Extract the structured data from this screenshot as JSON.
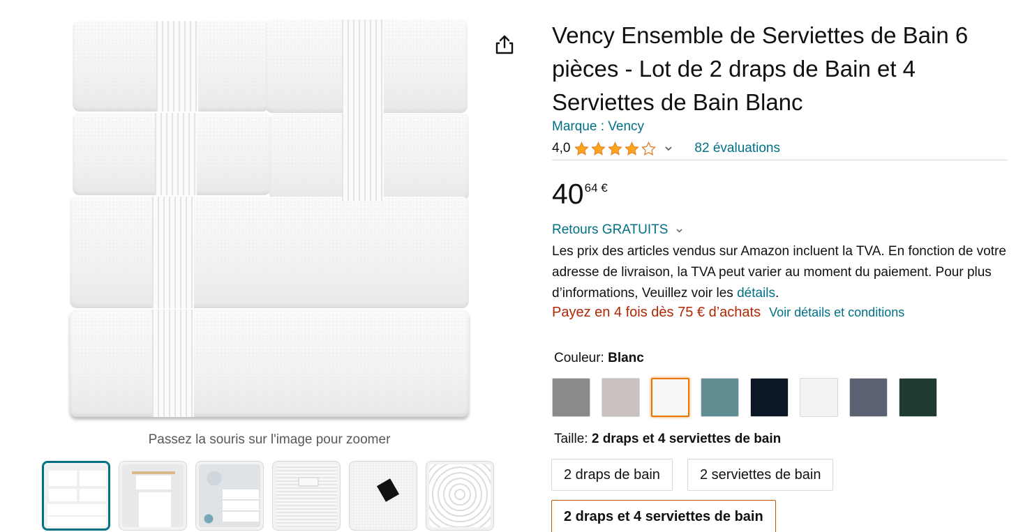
{
  "product": {
    "title": "Vency Ensemble de Serviettes de Bain 6 pièces - Lot de 2 draps de Bain et 4 Serviettes de Bain Blanc",
    "brand_link": "Marque : Vency",
    "rating_value": "4,0",
    "rating_stars": 4,
    "rating_max": 5,
    "reviews_link": "82 évaluations",
    "price_whole": "40",
    "price_fraction": "64 €",
    "returns_label": "Retours GRATUITS",
    "tva_text": "Les prix des articles vendus sur Amazon incluent la TVA. En fonction de votre adresse de livraison, la TVA peut varier au moment du paiement. Pour plus d’informations, Veuillez voir les ",
    "tva_link": "détails",
    "tva_end": ".",
    "installments_text": "Payez en 4 fois dès 75 € d’achats",
    "installments_link": "Voir détails et conditions"
  },
  "gallery": {
    "zoom_hint": "Passez la souris sur l'image pour zoomer",
    "thumbnails": [
      "towel-stack",
      "towel-rack",
      "bathroom-scene",
      "towel-texture",
      "towel-label",
      "towel-swirl"
    ],
    "active_thumbnail": 0
  },
  "color": {
    "label": "Couleur: ",
    "selected": "Blanc",
    "swatches": [
      {
        "name": "grey",
        "color": "#8a8a8a"
      },
      {
        "name": "taupe",
        "color": "#c9c2c0"
      },
      {
        "name": "white",
        "color": "#f7f7f7"
      },
      {
        "name": "teal",
        "color": "#5f8d92"
      },
      {
        "name": "navy",
        "color": "#0c1726"
      },
      {
        "name": "off-white",
        "color": "#f3f3f1"
      },
      {
        "name": "slate",
        "color": "#5d6272"
      },
      {
        "name": "dark-green",
        "color": "#1f3b31"
      }
    ],
    "selected_index": 2
  },
  "size": {
    "label": "Taille: ",
    "selected": "2 draps et 4 serviettes de bain",
    "options": [
      "2 draps de bain",
      "2 serviettes de bain",
      "2 draps et 4 serviettes de bain"
    ]
  },
  "colors": {
    "link": "#007185",
    "price_red": "#b12704",
    "selection_orange": "#e77600",
    "star": "#ffa41c"
  }
}
